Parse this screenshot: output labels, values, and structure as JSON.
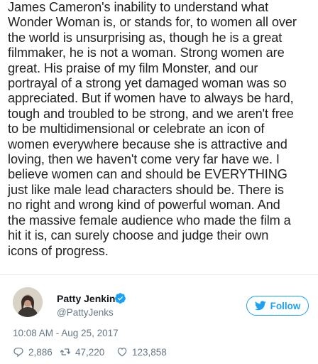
{
  "tweet": {
    "statement_lines": [
      "James Cameron's inability to understand what",
      "Wonder Woman is, or stands for, to women all over",
      "the world is unsurprising as, though he is a great",
      "filmmaker, he is not a woman. Strong women are",
      "great. His praise of my film Monster, and our",
      "portrayal of a strong yet damaged woman was so",
      "appreciated. But if women have to always be hard,",
      "tough and troubled to be strong, and we aren't free",
      "to be multidimensional or celebrate an icon of",
      "women everywhere because she is attractive and",
      "loving, then we haven't come very far have we. I",
      "believe women can and should be EVERYTHING",
      "just like male lead characters should be. There is",
      "no right and wrong kind of powerful woman. And",
      "the massive female audience who made the film a",
      "hit it is, can surely choose and judge their own",
      "icons of progress."
    ],
    "author": {
      "name": "Patty Jenkins",
      "handle": "@PattyJenks"
    },
    "follow_label": "Follow",
    "timestamp": "10:08 AM - Aug 25, 2017",
    "stats": {
      "replies": "2,886",
      "retweets": "47,220",
      "likes": "123,858"
    }
  },
  "colors": {
    "accent": "#1da1f2",
    "muted": "#657786",
    "text": "#14171a"
  },
  "icons": [
    "verified-badge-icon",
    "twitter-bird-icon",
    "reply-icon",
    "retweet-icon",
    "like-icon"
  ]
}
